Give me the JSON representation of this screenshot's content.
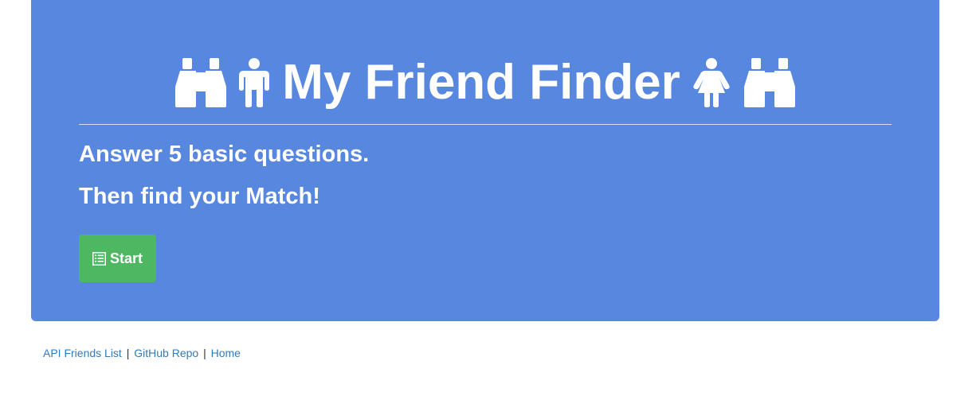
{
  "header": {
    "title": "My Friend Finder",
    "icons": [
      "binoculars-icon",
      "male-icon",
      "female-icon",
      "binoculars-icon"
    ]
  },
  "intro": {
    "line1": "Answer 5 basic questions.",
    "line2": "Then find your Match!"
  },
  "start_button": {
    "label": "Start",
    "icon": "list-icon"
  },
  "footer": {
    "links": [
      "API Friends List",
      "GitHub Repo",
      "Home"
    ],
    "separator": "|"
  },
  "colors": {
    "jumbotron": "#5887df",
    "button": "#4eb762",
    "link": "#337ab7"
  }
}
